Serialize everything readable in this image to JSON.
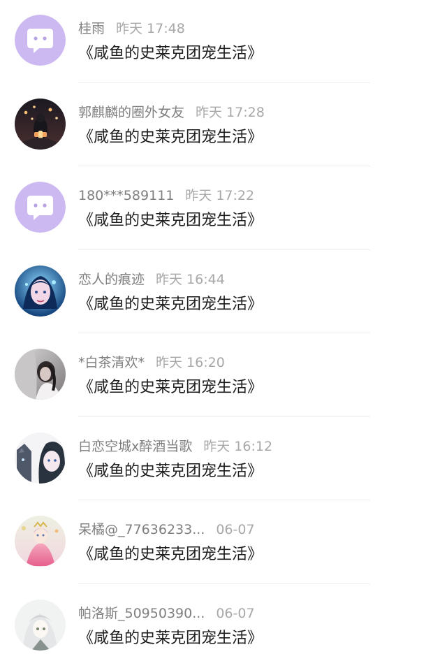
{
  "comments": [
    {
      "user": "桂雨",
      "time": "昨天 17:48",
      "text": "《咸鱼的史莱克团宠生活》",
      "avatar": "default-chat-avatar"
    },
    {
      "user": "郭麒麟的圈外女友",
      "time": "昨天 17:28",
      "text": "《咸鱼的史莱克团宠生活》",
      "avatar": "photo-avatar-lanterns"
    },
    {
      "user": "180***589111",
      "time": "昨天 17:22",
      "text": "《咸鱼的史莱克团宠生活》",
      "avatar": "default-chat-avatar"
    },
    {
      "user": "恋人的痕迹",
      "time": "昨天 16:44",
      "text": "《咸鱼的史莱克团宠生活》",
      "avatar": "anime-avatar-blue-girl"
    },
    {
      "user": "*白茶清欢*",
      "time": "昨天 16:20",
      "text": "《咸鱼的史莱克团宠生活》",
      "avatar": "photo-avatar-girl"
    },
    {
      "user": "白恋空城x醉酒当歌",
      "time": "昨天 16:12",
      "text": "《咸鱼的史莱克团宠生活》",
      "avatar": "anime-avatar-girl-cat"
    },
    {
      "user": "呆橘@_77636233...",
      "time": "06-07",
      "text": "《咸鱼的史莱克团宠生活》",
      "avatar": "anime-avatar-princess"
    },
    {
      "user": "帕洛斯_50950390...",
      "time": "06-07",
      "text": "《咸鱼的史莱克团宠生活》",
      "avatar": "anime-avatar-white-hair"
    }
  ],
  "colors": {
    "default_avatar_bg": "#cdb9f2",
    "name_text": "#7f7f7f",
    "time_text": "#a8a8a8",
    "message_text": "#1c1c1c",
    "divider": "#eeeeee"
  }
}
